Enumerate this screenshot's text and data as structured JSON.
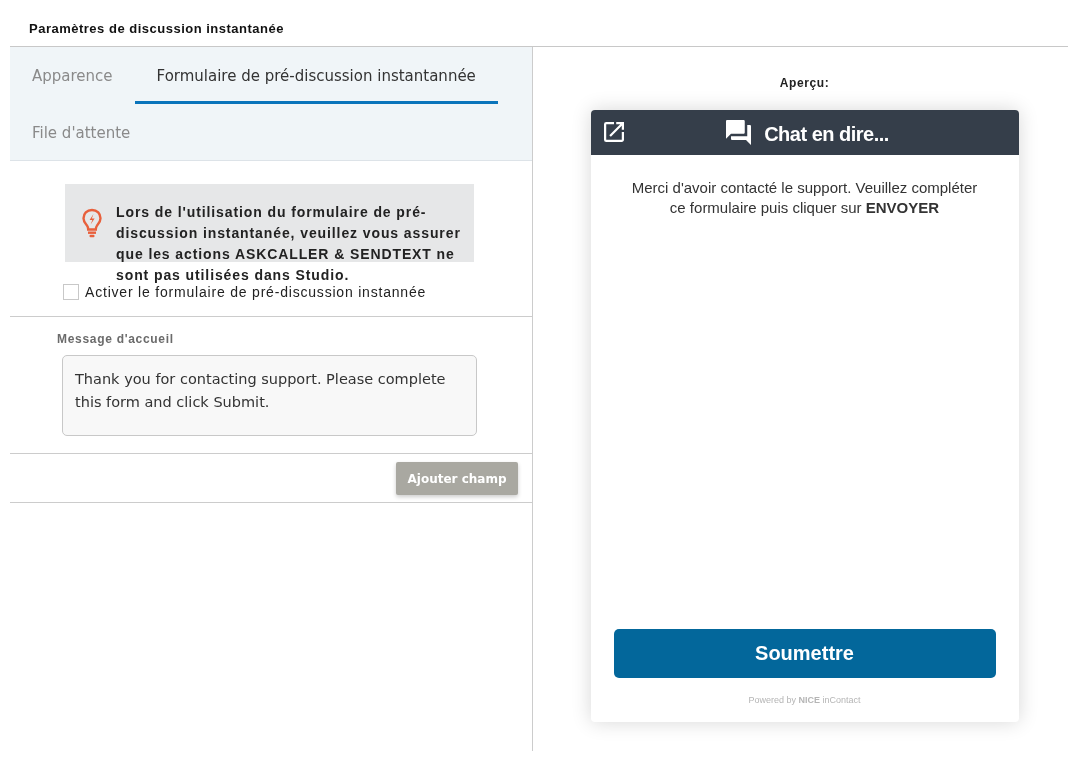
{
  "page_title": "Paramètres de discussion instantanée",
  "tabs": [
    {
      "label": "Apparence",
      "selected": false
    },
    {
      "label": "Formulaire de pré-discussion instantannée",
      "selected": true
    },
    {
      "label": "File d'attente",
      "selected": false
    }
  ],
  "info_banner": {
    "text": "Lors de l'utilisation du formulaire de pré-discussion instantanée, veuillez vous assurer que les actions ASKCALLER & SENDTEXT ne sont pas utilisées dans Studio."
  },
  "enable_checkbox": {
    "label": "Activer le formulaire de pré-discussion instannée",
    "checked": false
  },
  "welcome_message": {
    "label": "Message d'accueil",
    "value": "Thank you for contacting support. Please complete this form and click Submit."
  },
  "add_field_button": {
    "label": "Ajouter champ",
    "disabled": true
  },
  "preview": {
    "label": "Aperçu:",
    "widget": {
      "title": "Chat en dire...",
      "message": "Merci d'avoir contacté le support. Veuillez compléter ce formulaire puis cliquer sur **ENVOYER**",
      "submit_button": "Soumettre",
      "footer": "Powered by **NICE** inContact"
    }
  }
}
